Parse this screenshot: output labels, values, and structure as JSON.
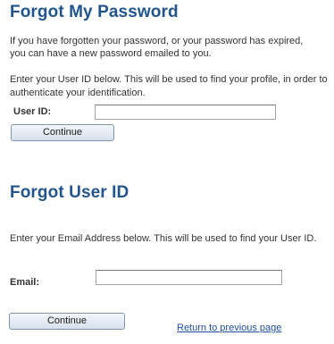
{
  "forgot_password": {
    "title": "Forgot My Password",
    "intro_line1": "If you have forgotten your password, or your password has expired,",
    "intro_line2": "you can have a new password emailed to you.",
    "instructions_line1": "Enter your User ID below. This will be used to find your profile, in order to",
    "instructions_line2": "authenticate your identification.",
    "user_id_label": "User ID:",
    "user_id_value": "",
    "continue_label": "Continue"
  },
  "forgot_user_id": {
    "title": "Forgot User ID",
    "instructions": "Enter your Email Address below. This will be used to find your User ID.",
    "email_label": "Email:",
    "email_value": "",
    "continue_label": "Continue",
    "return_link": "Return to previous page"
  }
}
